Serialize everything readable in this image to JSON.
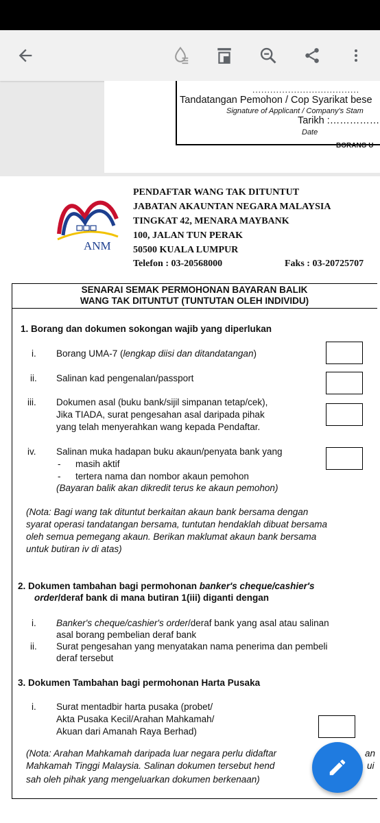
{
  "toolbar": {
    "back_icon": "arrow-left-icon",
    "icons": [
      "ink-drop-icon",
      "page-layout-icon",
      "zoom-out-icon",
      "share-icon",
      "more-vertical-icon"
    ]
  },
  "prev_page": {
    "dots": "....................................",
    "sig_my": "Tandatangan Pemohon / Cop Syarikat bese",
    "sig_en": "Signature of Applicant / Company's Stam",
    "tarikh": "Tarikh :……………",
    "date": "Date",
    "borang": "BORANG U"
  },
  "header": {
    "logo_text": "ANM",
    "line1": "PENDAFTAR WANG TAK DITUNTUT",
    "line2": "JABATAN AKAUNTAN NEGARA MALAYSIA",
    "line3": "TINGKAT 42, MENARA MAYBANK",
    "line4": "100, JALAN TUN PERAK",
    "line5": "50500 KUALA LUMPUR",
    "telefon": "Telefon  : 03-20568000",
    "faks": "Faks : 03-20725707"
  },
  "form": {
    "title1": "SENARAI SEMAK PERMOHONAN BAYARAN BALIK",
    "title2": "WANG TAK DITUNTUT (TUNTUTAN OLEH INDIVIDU)",
    "s1": {
      "heading": "1.  Borang dan dokumen sokongan wajib yang diperlukan",
      "i_num": "i.",
      "i_text": "Borang UMA-7 (",
      "i_italic": "lengkap diisi dan ditandatangan",
      "i_close": ")",
      "ii_num": "ii.",
      "ii_text": "Salinan kad pengenalan/passport",
      "iii_num": "iii.",
      "iii_l1": "Dokumen asal (buku bank/sijil simpanan tetap/cek),",
      "iii_l2": "Jika TIADA, surat pengesahan asal daripada pihak",
      "iii_l3": "yang telah menyerahkan wang kepada Pendaftar.",
      "iv_num": "iv.",
      "iv_l1": "Salinan muka hadapan buku akaun/penyata bank yang",
      "iv_l2": "masih aktif",
      "iv_l3": "tertera nama dan nombor akaun pemohon",
      "iv_l4": "(Bayaran balik akan dikredit terus ke akaun pemohon)",
      "dash": "-",
      "note_l1": "(Nota: Bagi wang tak dituntut berkaitan akaun bank bersama dengan",
      "note_l2": "syarat operasi tandatangan bersama, tuntutan hendaklah dibuat bersama",
      "note_l3": "oleh semua pemegang akaun. Berikan maklumat  akaun bank bersama",
      "note_l4": "untuk butiran iv di atas)"
    },
    "s2": {
      "h1a": "2.  Dokumen tambahan bagi permohonan ",
      "h1b": "banker's cheque/cashier's",
      "h2a": "order",
      "h2b": "/deraf bank di mana butiran 1(iii) diganti dengan",
      "i_num": "i.",
      "i_l1a": "Banker's cheque/cashier's order",
      "i_l1b": "/deraf bank yang asal atau salinan",
      "i_l2": "asal borang pembelian deraf bank",
      "ii_num": "ii.",
      "ii_l1": "Surat pengesahan yang menyatakan nama penerima dan pembeli",
      "ii_l2": "deraf tersebut"
    },
    "s3": {
      "heading": "3.  Dokumen Tambahan bagi permohonan Harta Pusaka",
      "i_num": "i.",
      "i_l1": "Surat mentadbir harta pusaka (probet/",
      "i_l2": "Akta Pusaka Kecil/Arahan Mahkamah/",
      "i_l3": "Akuan dari Amanah Raya Berhad)",
      "note_l1": "(Nota: Arahan Mahkamah daripada luar negara perlu didaftar",
      "note_l1_end": "an",
      "note_l2": "Mahkamah Tinggi Malaysia. Salinan dokumen tersebut hend",
      "note_l2_end": "ui",
      "note_l3": "sah oleh pihak yang mengeluarkan dokumen berkenaan)"
    }
  },
  "fab": {
    "icon": "pencil-edit-icon"
  },
  "colors": {
    "fab": "#1f7be0",
    "logo_red": "#c8102e",
    "logo_blue": "#1d3f8f",
    "logo_yellow": "#f2c200"
  }
}
